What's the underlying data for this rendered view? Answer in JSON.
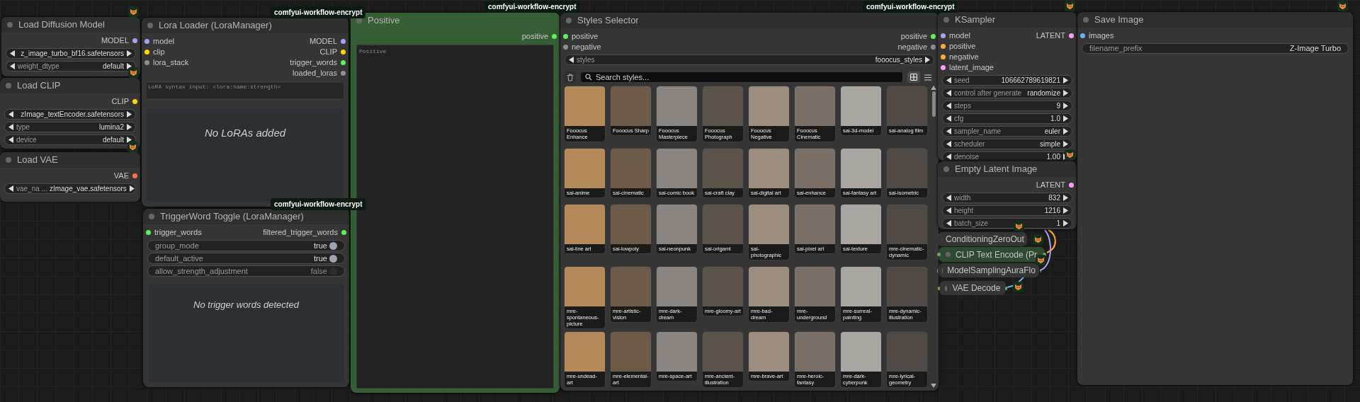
{
  "badges": [
    "comfyui-workflow-encrypt",
    "comfyui-workflow-encrypt",
    "comfyui-workflow-encrypt",
    "comfyui-workflow-encrypt"
  ],
  "nodes": [
    {
      "kind": "standard",
      "title": "Load Diffusion Model",
      "outputs": [
        {
          "label": "MODEL",
          "color": "#a8a3f0"
        }
      ],
      "widgets": [
        {
          "kind": "combo",
          "value": "z_image_turbo_bf16.safetensors"
        },
        {
          "kind": "combo",
          "label": "weight_dtype",
          "value": "default"
        }
      ]
    },
    {
      "kind": "standard",
      "title": "Load CLIP",
      "outputs": [
        {
          "label": "CLIP",
          "color": "#ffd500"
        }
      ],
      "widgets": [
        {
          "kind": "combo",
          "value": "zImage_textEncoder.safetensors"
        },
        {
          "kind": "combo",
          "label": "type",
          "value": "lumina2"
        },
        {
          "kind": "combo",
          "label": "device",
          "value": "default"
        }
      ]
    },
    {
      "kind": "standard",
      "title": "Load VAE",
      "outputs": [
        {
          "label": "VAE",
          "color": "#ff6e4f"
        }
      ],
      "widgets": [
        {
          "kind": "combo",
          "label": "vae_na ...",
          "value": "zImage_vae.safetensors"
        }
      ]
    },
    {
      "kind": "lora",
      "title": "Lora Loader (LoraManager)",
      "inputs": [
        {
          "label": "model",
          "color": "#a8a3f0"
        },
        {
          "label": "clip",
          "color": "#ffd500"
        },
        {
          "label": "lora_stack",
          "color": "#8a8f99"
        }
      ],
      "outputs": [
        {
          "label": "MODEL",
          "color": "#a8a3f0"
        },
        {
          "label": "CLIP",
          "color": "#ffd500"
        },
        {
          "label": "trigger_words",
          "color": "#5ef05e"
        },
        {
          "label": "loaded_loras",
          "color": "#8a8f99"
        }
      ],
      "placeholder": "LoRA syntax input: <lora:name:strength>",
      "empty_message": "No LoRAs added"
    },
    {
      "kind": "trigger",
      "title": "TriggerWord Toggle (LoraManager)",
      "inputs": [
        {
          "label": "trigger_words",
          "color": "#5ef05e"
        }
      ],
      "outputs": [
        {
          "label": "filtered_trigger_words",
          "color": "#5ef05e"
        }
      ],
      "widgets": [
        {
          "kind": "toggle",
          "label": "group_mode",
          "value": "true",
          "on": true
        },
        {
          "kind": "toggle",
          "label": "default_active",
          "value": "true",
          "on": true
        },
        {
          "kind": "toggle",
          "label": "allow_strength_adjustment",
          "value": "false",
          "on": false
        }
      ],
      "empty_message": "No trigger words detected"
    },
    {
      "kind": "prompt",
      "title": "Positive",
      "color": "#355e35",
      "outputs": [
        {
          "label": "positive",
          "color": "#5ef05e"
        }
      ],
      "placeholder": "Positive"
    },
    {
      "kind": "styles",
      "title": "Styles Selector",
      "inputs": [
        {
          "label": "positive",
          "color": "#5ef05e"
        },
        {
          "label": "negative",
          "color": "#8a8f99"
        }
      ],
      "outputs": [
        {
          "label": "positive",
          "color": "#5ef05e"
        },
        {
          "label": "negative",
          "color": "#8a8f99"
        }
      ],
      "widgets": [
        {
          "kind": "combo",
          "label": "styles",
          "value": "fooocus_styles"
        }
      ],
      "search_placeholder": "Search styles...",
      "views": [
        {
          "kind": "grid",
          "selected": true
        },
        {
          "kind": "list",
          "selected": false
        }
      ],
      "cards": [
        {
          "label": "Fooocus Enhance"
        },
        {
          "label": "Fooocus Sharp"
        },
        {
          "label": "Fooocus Masterpiece"
        },
        {
          "label": "Fooocus Photograph"
        },
        {
          "label": "Fooocus Negative"
        },
        {
          "label": "Fooocus Cinematic"
        },
        {
          "label": "sai-3d-model"
        },
        {
          "label": "sai-analog film"
        },
        {
          "label": "sai-anime"
        },
        {
          "label": "sai-cinematic"
        },
        {
          "label": "sai-comic book"
        },
        {
          "label": "sai-craft clay"
        },
        {
          "label": "sai-digital art"
        },
        {
          "label": "sai-enhance"
        },
        {
          "label": "sai-fantasy art"
        },
        {
          "label": "sai-isometric"
        },
        {
          "label": "sai-line art"
        },
        {
          "label": "sai-lowpoly"
        },
        {
          "label": "sai-neonpunk"
        },
        {
          "label": "sai-origami"
        },
        {
          "label": "sai-photographic"
        },
        {
          "label": "sai-pixel art"
        },
        {
          "label": "sai-texture"
        },
        {
          "label": "mre-cinematic-dynamic"
        },
        {
          "label": "mre-spontaneous-picture"
        },
        {
          "label": "mre-artistic-vision"
        },
        {
          "label": "mre-dark-dream"
        },
        {
          "label": "mre-gloomy-art"
        },
        {
          "label": "mre-bad-dream"
        },
        {
          "label": "mre-underground"
        },
        {
          "label": "mre-surreal-painting"
        },
        {
          "label": "mre-dynamic-illustration"
        },
        {
          "label": "mre-undead-art"
        },
        {
          "label": "mre-elemental-art"
        },
        {
          "label": "mre-space-art"
        },
        {
          "label": "mre-ancient-illustration"
        },
        {
          "label": "mre-brave-art"
        },
        {
          "label": "mre-heroic-fantasy"
        },
        {
          "label": "mre-dark-cyberpunk"
        },
        {
          "label": "mre-lyrical-geometry"
        }
      ]
    },
    {
      "kind": "standard",
      "title": "KSampler",
      "inputs": [
        {
          "label": "model",
          "color": "#a8a3f0"
        },
        {
          "label": "positive",
          "color": "#ffa931"
        },
        {
          "label": "negative",
          "color": "#ffa931"
        },
        {
          "label": "latent_image",
          "color": "#ff9cf9"
        }
      ],
      "outputs": [
        {
          "label": "LATENT",
          "color": "#ff9cf9"
        }
      ],
      "widgets": [
        {
          "kind": "combo",
          "label": "seed",
          "value": "106662789619821"
        },
        {
          "kind": "combo",
          "label": "control after generate",
          "value": "randomize"
        },
        {
          "kind": "combo",
          "label": "steps",
          "value": "9"
        },
        {
          "kind": "combo",
          "label": "cfg",
          "value": "1.0"
        },
        {
          "kind": "combo",
          "label": "sampler_name",
          "value": "euler"
        },
        {
          "kind": "combo",
          "label": "scheduler",
          "value": "simple"
        },
        {
          "kind": "combo",
          "label": "denoise",
          "value": "1.00"
        }
      ]
    },
    {
      "kind": "standard",
      "title": "Empty Latent Image",
      "outputs": [
        {
          "label": "LATENT",
          "color": "#ff9cf9"
        }
      ],
      "widgets": [
        {
          "kind": "combo",
          "label": "width",
          "value": "832"
        },
        {
          "kind": "combo",
          "label": "height",
          "value": "1216"
        },
        {
          "kind": "combo",
          "label": "batch_size",
          "value": "1"
        }
      ]
    },
    {
      "kind": "collapsed",
      "title": "ConditioningZeroOut"
    },
    {
      "kind": "collapsed",
      "title": "CLIP Text Encode (Pr",
      "color": "#2f4a33"
    },
    {
      "kind": "collapsed",
      "title": "ModelSamplingAuraFlo"
    },
    {
      "kind": "collapsed",
      "title": "VAE Decode"
    },
    {
      "kind": "standard",
      "title": "Save Image",
      "inputs": [
        {
          "label": "images",
          "color": "#64b5f6"
        }
      ],
      "widgets": [
        {
          "kind": "text",
          "label": "filename_prefix",
          "value": "Z-Image Turbo"
        }
      ]
    }
  ]
}
